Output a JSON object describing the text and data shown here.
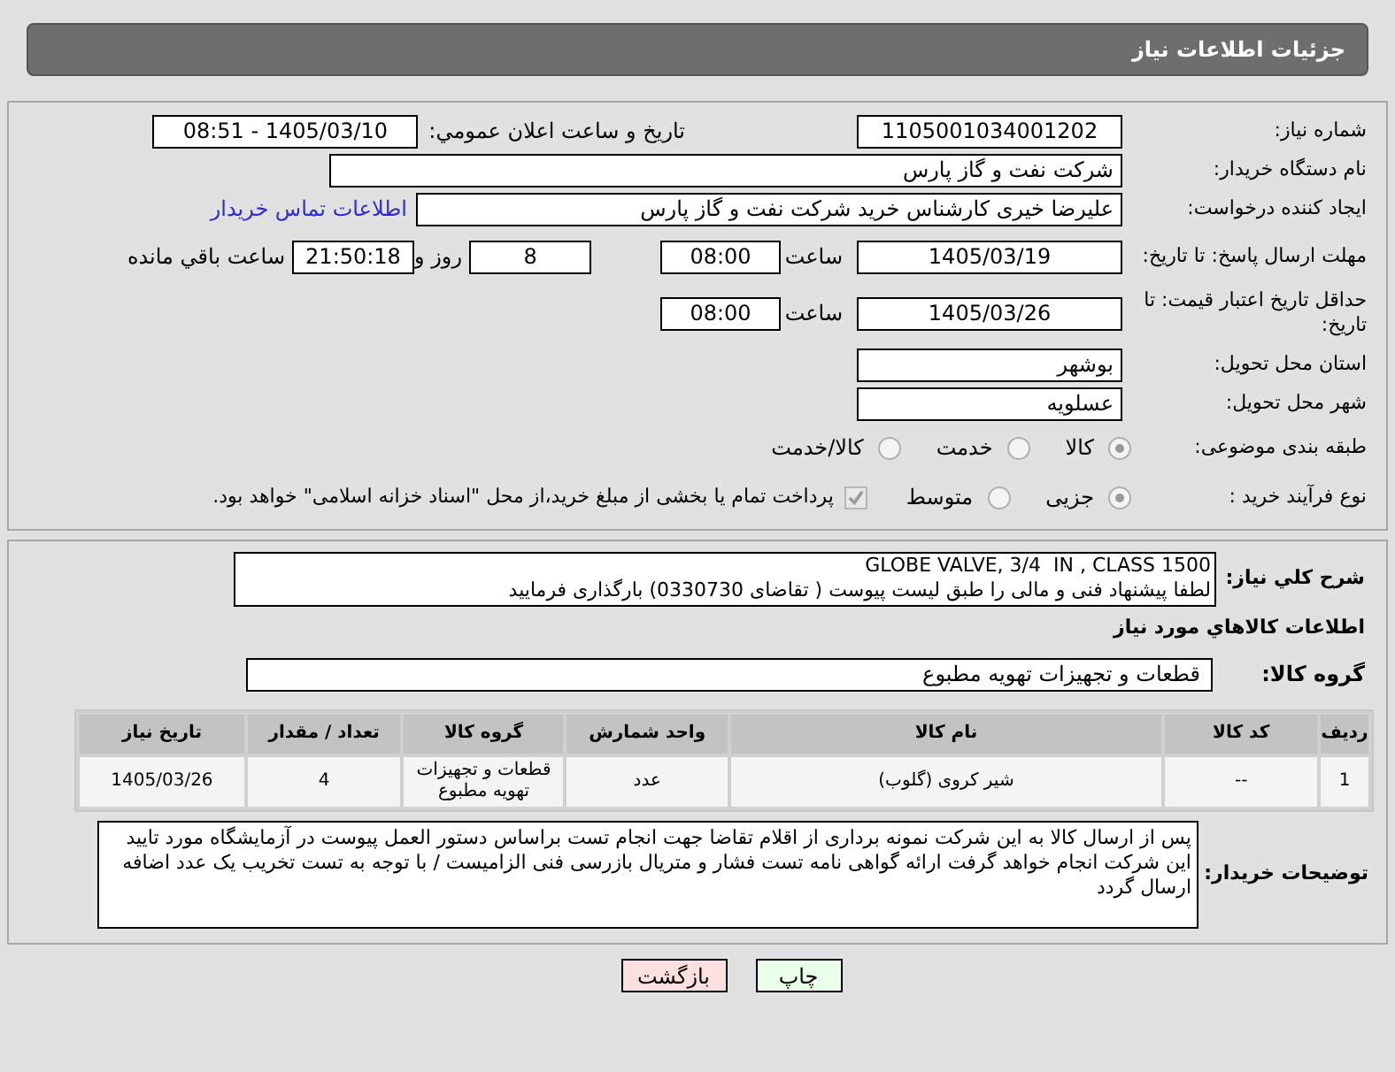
{
  "header": {
    "title": "جزئیات اطلاعات نیاز"
  },
  "need_number": {
    "label": "شماره نیاز:",
    "value": "1105001034001202"
  },
  "announce": {
    "label": "تاریخ و ساعت اعلان عمومي:",
    "value": "1405/03/10 - 08:51"
  },
  "buyer_org": {
    "label": "نام دستگاه خریدار:",
    "value": "شرکت نفت و گاز پارس"
  },
  "requester": {
    "label": "ایجاد کننده درخواست:",
    "value": "علیرضا  خیری کارشناس خرید  شرکت نفت و گاز پارس",
    "link": "اطلاعات تماس خریدار"
  },
  "reply_deadline": {
    "label": "مهلت ارسال پاسخ: تا تاریخ:",
    "date": "1405/03/19",
    "time_label": "ساعت",
    "time": "08:00",
    "days": "8",
    "days_label": "روز و",
    "remaining": "21:50:18",
    "remaining_label": "ساعت باقي مانده"
  },
  "price_validity": {
    "label": "حداقل تاریخ اعتبار قیمت: تا تاریخ:",
    "date": "1405/03/26",
    "time_label": "ساعت",
    "time": "08:00"
  },
  "province": {
    "label": "استان محل تحویل:",
    "value": "بوشهر"
  },
  "city": {
    "label": "شهر محل تحویل:",
    "value": "عسلویه"
  },
  "category": {
    "label": "طبقه بندی موضوعی:",
    "options": [
      {
        "label": "کالا",
        "selected": true
      },
      {
        "label": "خدمت",
        "selected": false
      },
      {
        "label": "کالا/خدمت",
        "selected": false
      }
    ]
  },
  "process": {
    "label": "نوع فرآیند خرید :",
    "options": [
      {
        "label": "جزیی",
        "selected": true
      },
      {
        "label": "متوسط",
        "selected": false
      }
    ],
    "treasury": {
      "label": "پرداخت تمام یا بخشی از مبلغ خرید،از محل \"اسناد خزانه اسلامی\" خواهد بود.",
      "checked": true
    }
  },
  "description": {
    "label": "شرح کلي نیاز:",
    "lines": [
      "GLOBE VALVE, 3/4  IN , CLASS 1500",
      "لطفا پیشنهاد فنی و مالی را طبق لیست پیوست ( تقاضای 0330730) بارگذاری فرمایید"
    ]
  },
  "items_heading": "اطلاعات کالاهاي مورد نیاز",
  "group": {
    "label": "گروه کالا:",
    "value": "قطعات و تجهیزات تهویه مطبوع"
  },
  "table": {
    "columns": [
      "ردیف",
      "کد کالا",
      "نام کالا",
      "واحد شمارش",
      "گروه کالا",
      "تعداد / مقدار",
      "تاریخ نیاز"
    ],
    "rows": [
      [
        "1",
        "--",
        "شیر کروی (گلوب)",
        "عدد",
        "قطعات و تجهیزات تهویه مطبوع",
        "4",
        "1405/03/26"
      ]
    ]
  },
  "buyer_notes": {
    "label": "توضیحات خریدار:",
    "value": "پس از ارسال کالا به این شرکت نمونه برداری از اقلام تقاضا جهت انجام تست  براساس دستور العمل پیوست  در آزمایشگاه مورد تایید این شرکت انجام خواهد گرفت ارائه گواهی نامه تست فشار و متریال بازرسی فنی الزامیست / با توجه به تست تخریب  یک عدد اضافه ارسال گردد"
  },
  "buttons": [
    {
      "label": "چاپ",
      "kind": "print"
    },
    {
      "label": "بازگشت",
      "kind": "back"
    }
  ]
}
